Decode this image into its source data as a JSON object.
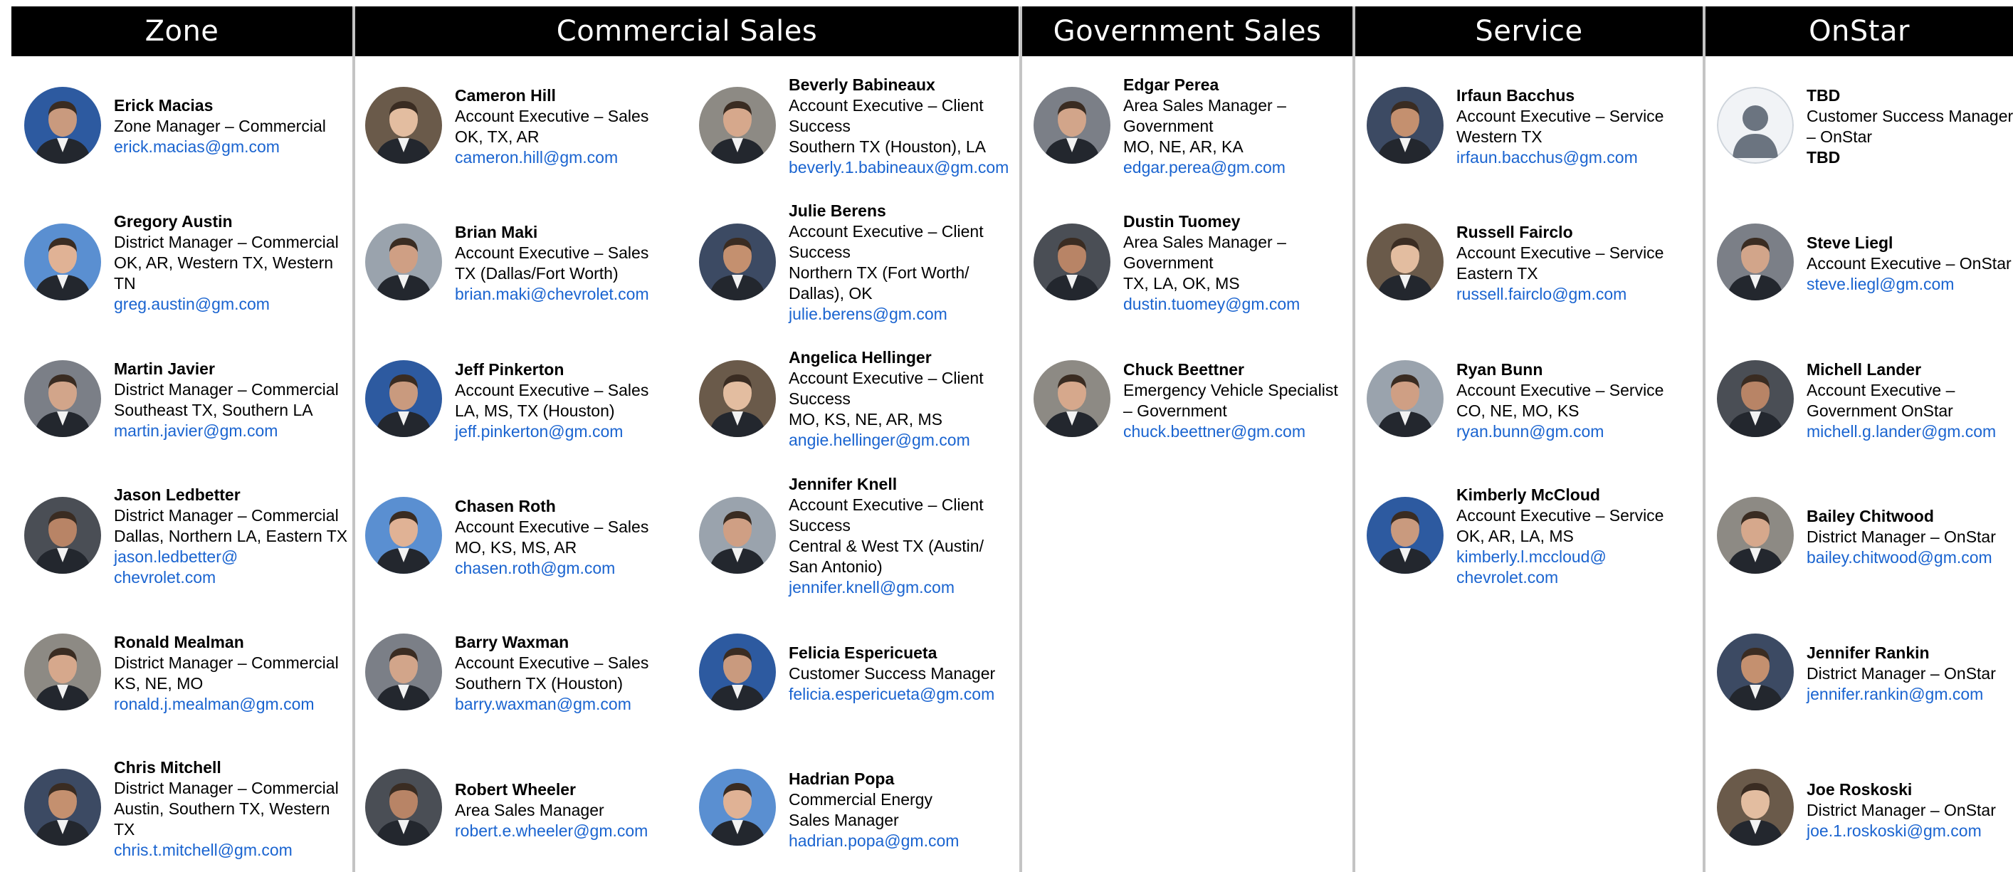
{
  "headers": {
    "zone": "Zone",
    "commercial": "Commercial Sales",
    "government": "Government Sales",
    "service": "Service",
    "onstar": "OnStar"
  },
  "zone": [
    {
      "name": "Erick Macias",
      "lines": [
        "Zone Manager – Commercial"
      ],
      "email": [
        "erick.macias@gm.com"
      ],
      "avatar": "photo-icon"
    },
    {
      "name": "Gregory Austin",
      "lines": [
        "District Manager – Commercial",
        "OK, AR, Western TX, Western",
        "TN"
      ],
      "email": [
        "greg.austin@gm.com"
      ],
      "avatar": "photo-icon"
    },
    {
      "name": "Martin Javier",
      "lines": [
        "District Manager – Commercial",
        "Southeast TX, Southern LA"
      ],
      "email": [
        "martin.javier@gm.com"
      ],
      "avatar": "photo-icon"
    },
    {
      "name": "Jason Ledbetter",
      "lines": [
        "District Manager – Commercial",
        "Dallas, Northern LA, Eastern TX"
      ],
      "email": [
        "jason.ledbetter@",
        "chevrolet.com"
      ],
      "avatar": "photo-icon"
    },
    {
      "name": "Ronald Mealman",
      "lines": [
        "District Manager – Commercial",
        "KS, NE, MO"
      ],
      "email": [
        "ronald.j.mealman@gm.com"
      ],
      "avatar": "photo-icon"
    },
    {
      "name": "Chris Mitchell",
      "lines": [
        "District Manager – Commercial",
        "Austin, Southern TX, Western",
        "TX"
      ],
      "email": [
        "chris.t.mitchell@gm.com"
      ],
      "avatar": "photo-icon"
    }
  ],
  "commercial_a": [
    {
      "name": "Cameron Hill",
      "lines": [
        "Account Executive – Sales",
        "OK, TX, AR"
      ],
      "email": [
        "cameron.hill@gm.com"
      ],
      "avatar": "photo-icon"
    },
    {
      "name": "Brian Maki",
      "lines": [
        "Account Executive – Sales",
        "TX (Dallas/Fort Worth)"
      ],
      "email": [
        "brian.maki@chevrolet.com"
      ],
      "avatar": "photo-icon"
    },
    {
      "name": "Jeff Pinkerton",
      "lines": [
        "Account Executive – Sales",
        "LA, MS, TX (Houston)"
      ],
      "email": [
        "jeff.pinkerton@gm.com"
      ],
      "avatar": "photo-icon"
    },
    {
      "name": "Chasen Roth",
      "lines": [
        "Account Executive – Sales",
        "MO, KS, MS, AR"
      ],
      "email": [
        "chasen.roth@gm.com"
      ],
      "avatar": "photo-icon"
    },
    {
      "name": "Barry Waxman",
      "lines": [
        "Account Executive – Sales",
        "Southern TX (Houston)"
      ],
      "email": [
        "barry.waxman@gm.com"
      ],
      "avatar": "photo-icon"
    },
    {
      "name": "Robert Wheeler",
      "lines": [
        "Area Sales Manager"
      ],
      "email": [
        "robert.e.wheeler@gm.com"
      ],
      "avatar": "photo-icon"
    }
  ],
  "commercial_b": [
    {
      "name": "Beverly Babineaux",
      "lines": [
        "Account Executive – Client",
        "Success",
        "Southern TX (Houston), LA"
      ],
      "email": [
        "beverly.1.babineaux@gm.com"
      ],
      "avatar": "photo-icon"
    },
    {
      "name": "Julie Berens",
      "lines": [
        "Account Executive – Client",
        "Success",
        "Northern TX (Fort Worth/",
        "Dallas), OK"
      ],
      "email": [
        "julie.berens@gm.com"
      ],
      "avatar": "photo-icon"
    },
    {
      "name": "Angelica Hellinger",
      "lines": [
        "Account Executive – Client",
        "Success",
        "MO, KS, NE, AR, MS"
      ],
      "email": [
        "angie.hellinger@gm.com"
      ],
      "avatar": "photo-icon"
    },
    {
      "name": "Jennifer Knell",
      "lines": [
        "Account Executive – Client",
        "Success",
        "Central & West TX (Austin/",
        "San Antonio)"
      ],
      "email": [
        "jennifer.knell@gm.com"
      ],
      "avatar": "photo-icon"
    },
    {
      "name": "Felicia Espericueta",
      "lines": [
        "Customer Success Manager"
      ],
      "email": [
        "felicia.espericueta@gm.com"
      ],
      "avatar": "photo-icon"
    },
    {
      "name": "Hadrian Popa",
      "lines": [
        "Commercial Energy",
        "Sales Manager"
      ],
      "email": [
        "hadrian.popa@gm.com"
      ],
      "avatar": "photo-icon"
    }
  ],
  "government": [
    {
      "name": "Edgar Perea",
      "lines": [
        "Area Sales Manager –",
        "Government",
        "MO, NE, AR, KA"
      ],
      "email": [
        "edgar.perea@gm.com"
      ],
      "avatar": "photo-icon"
    },
    {
      "name": "Dustin Tuomey",
      "lines": [
        "Area Sales Manager –",
        "Government",
        "TX, LA, OK, MS"
      ],
      "email": [
        "dustin.tuomey@gm.com"
      ],
      "avatar": "photo-icon"
    },
    {
      "name": "Chuck Beettner",
      "lines": [
        "Emergency Vehicle Specialist",
        "– Government"
      ],
      "email": [
        "chuck.beettner@gm.com"
      ],
      "avatar": "photo-icon"
    }
  ],
  "service": [
    {
      "name": "Irfaun Bacchus",
      "lines": [
        "Account Executive – Service",
        "Western TX"
      ],
      "email": [
        "irfaun.bacchus@gm.com"
      ],
      "avatar": "photo-icon"
    },
    {
      "name": "Russell Fairclo",
      "lines": [
        "Account Executive – Service",
        "Eastern TX"
      ],
      "email": [
        "russell.fairclo@gm.com"
      ],
      "avatar": "photo-icon"
    },
    {
      "name": "Ryan Bunn",
      "lines": [
        "Account Executive – Service",
        "CO, NE, MO, KS"
      ],
      "email": [
        "ryan.bunn@gm.com"
      ],
      "avatar": "photo-icon"
    },
    {
      "name": "Kimberly McCloud",
      "lines": [
        "Account Executive – Service",
        "OK, AR, LA, MS"
      ],
      "email": [
        "kimberly.l.mccloud@",
        "chevrolet.com"
      ],
      "avatar": "photo-icon"
    }
  ],
  "onstar": [
    {
      "name": "TBD",
      "lines": [
        "Customer Success Manager",
        "– OnStar"
      ],
      "bold_extra": "TBD",
      "email": [],
      "avatar": "placeholder-silhouette-icon"
    },
    {
      "name": "Steve Liegl",
      "lines": [
        "Account Executive – OnStar"
      ],
      "email": [
        "steve.liegl@gm.com"
      ],
      "avatar": "photo-icon"
    },
    {
      "name": "Michell Lander",
      "lines": [
        "Account Executive –",
        "Government OnStar"
      ],
      "email": [
        "michell.g.lander@gm.com"
      ],
      "avatar": "photo-icon"
    },
    {
      "name": "Bailey Chitwood",
      "lines": [
        "District Manager – OnStar"
      ],
      "email": [
        "bailey.chitwood@gm.com"
      ],
      "avatar": "photo-icon"
    },
    {
      "name": "Jennifer Rankin",
      "lines": [
        "District Manager – OnStar"
      ],
      "email": [
        "jennifer.rankin@gm.com"
      ],
      "avatar": "photo-icon"
    },
    {
      "name": "Joe Roskoski",
      "lines": [
        "District Manager – OnStar"
      ],
      "email": [
        "joe.1.roskoski@gm.com"
      ],
      "avatar": "photo-icon"
    }
  ],
  "colors": {
    "header_bg": "#000000",
    "header_text": "#ffffff",
    "email": "#1a64d0",
    "divider": "#c4c4c4"
  }
}
